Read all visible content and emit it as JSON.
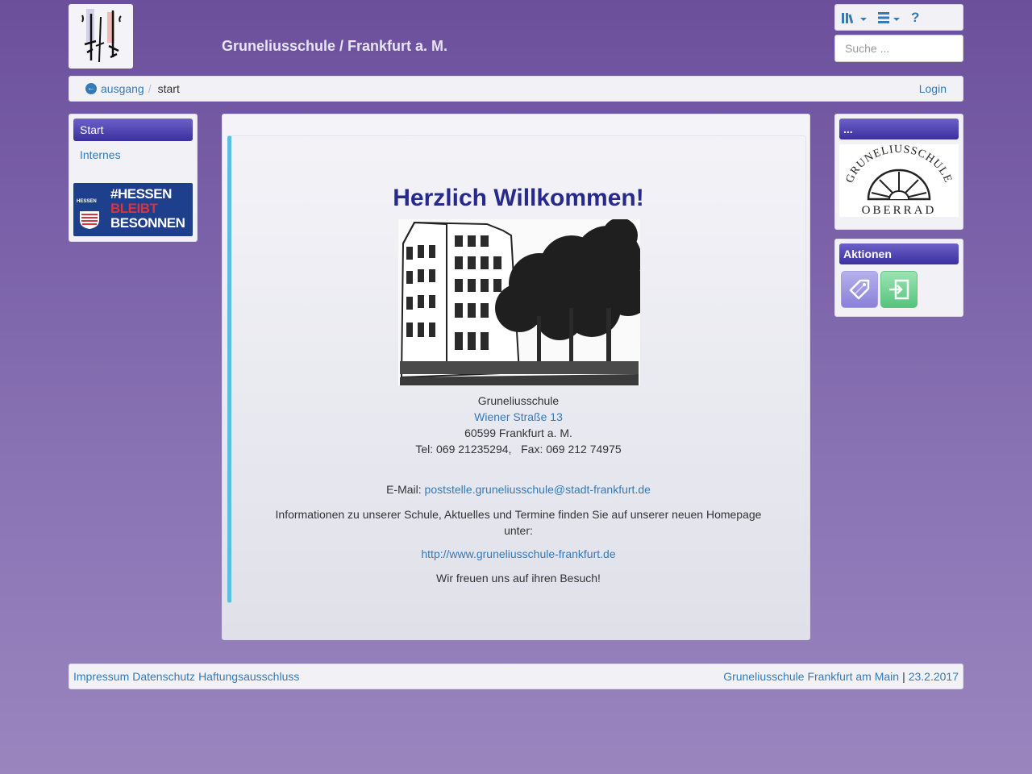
{
  "header": {
    "site_title": "Gruneliusschule / Frankfurt a. M.",
    "search_placeholder": "Suche ...",
    "help_label": "?",
    "icons": [
      "library-icon",
      "menu-icon"
    ]
  },
  "breadcrumb": {
    "home": "ausgang",
    "separator": "/",
    "current": "start",
    "login": "Login"
  },
  "sidebar": {
    "active_item": "Start",
    "items": [
      "Internes"
    ],
    "banner": {
      "small": "HESSEN",
      "line1": "#HESSEN",
      "line2": "BLEIBT",
      "line3": "BESONNEN"
    }
  },
  "main": {
    "welcome": "Herzlich Willkommen!",
    "school_name": "Gruneliusschule",
    "street": "Wiener Straße 13",
    "city": "60599 Frankfurt a. M.",
    "phone": "Tel: 069 21235294,   Fax: 069 212 74975",
    "email_label": "E-Mail: ",
    "email": "poststelle.gruneliusschule@stadt-frankfurt.de",
    "info": "Informationen zu unserer Schule, Aktuelles und Termine finden Sie auf unserer neuen Homepage unter:",
    "homepage": "http://www.gruneliusschule-frankfurt.de",
    "closing": "Wir freuen uns auf ihren Besuch!"
  },
  "right": {
    "panel1_title": "...",
    "seal_top": "GRUNELIUSSCHULE",
    "seal_bottom": "OBERRAD",
    "panel2_title": "Aktionen"
  },
  "footer": {
    "impressum": "Impressum",
    "datenschutz": "Datenschutz",
    "haftung": "Haftungsausschluss",
    "org": "Gruneliusschule Frankfurt am Main",
    "sep": "|",
    "date": "23.2.2017"
  },
  "colors": {
    "accent": "#337ab7",
    "panel_head": "#3a2fa0",
    "welcome": "#262a8c",
    "info_border": "#5bc0de"
  }
}
